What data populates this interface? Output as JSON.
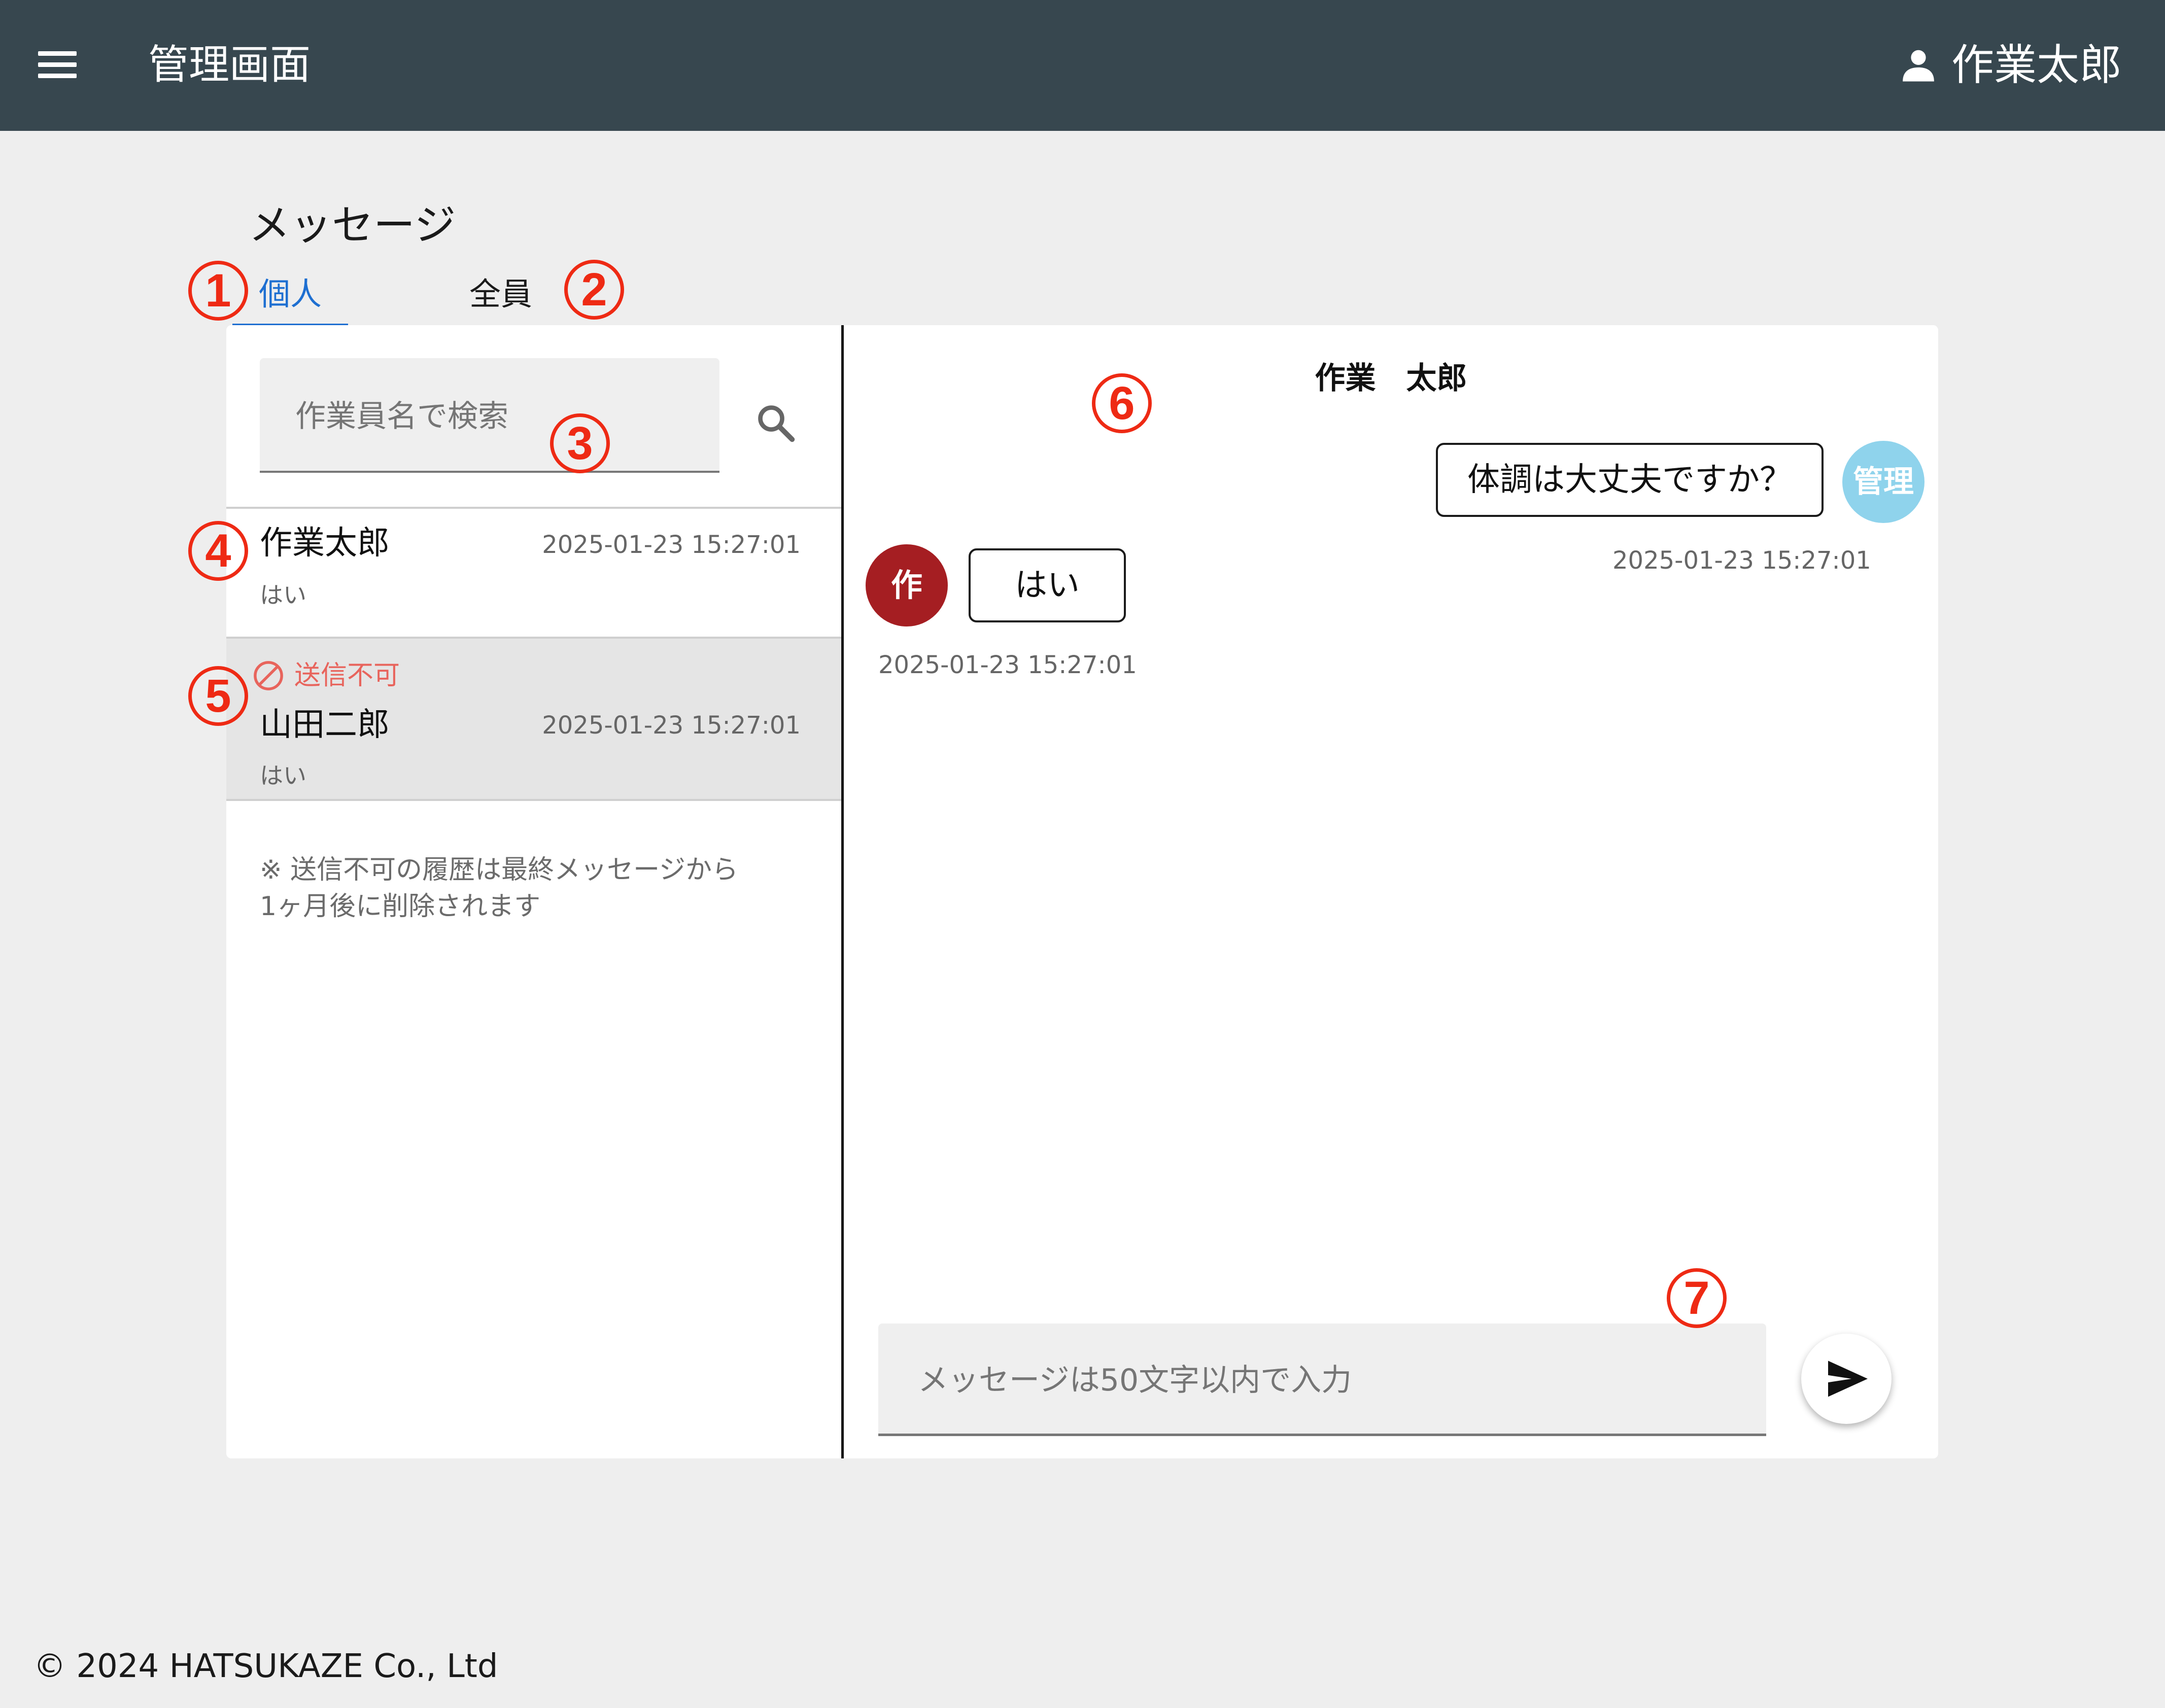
{
  "header": {
    "title": "管理画面",
    "user_name": "作業太郎"
  },
  "page": {
    "title": "メッセージ"
  },
  "tabs": [
    {
      "label": "個人",
      "active": true
    },
    {
      "label": "全員",
      "active": false
    }
  ],
  "search": {
    "placeholder": "作業員名で検索",
    "value": ""
  },
  "conversations": [
    {
      "name": "作業太郎",
      "time": "2025-01-23 15:27:01",
      "preview": "はい",
      "blocked": false
    },
    {
      "name": "山田二郎",
      "time": "2025-01-23 15:27:01",
      "preview": "はい",
      "blocked": true,
      "blocked_label": "送信不可"
    }
  ],
  "notice": "※ 送信不可の履歴は最終メッセージから\n1ヶ月後に削除されます",
  "chat": {
    "title": "作業　太郎",
    "messages": [
      {
        "sender": "admin",
        "avatar": "管理",
        "text": "体調は大丈夫ですか？",
        "time": "2025-01-23 15:27:01"
      },
      {
        "sender": "worker",
        "avatar": "作",
        "text": "はい",
        "time": "2025-01-23 15:27:01"
      }
    ],
    "input_placeholder": "メッセージは50文字以内で入力",
    "input_value": ""
  },
  "markers": [
    "1",
    "2",
    "3",
    "4",
    "5",
    "6",
    "7"
  ],
  "icons": {
    "menu": "menu-icon",
    "user": "person-icon",
    "search": "search-icon",
    "blocked": "block-icon",
    "send": "send-icon"
  },
  "colors": {
    "appbar": "#37474f",
    "accent": "#1e6fd1",
    "marker": "#ee2a14",
    "blocked": "#e8645c",
    "admin_avatar": "#8fd3ec",
    "worker_avatar": "#a51e22"
  },
  "footer": {
    "copyright": "© 2024 HATSUKAZE Co., Ltd"
  }
}
